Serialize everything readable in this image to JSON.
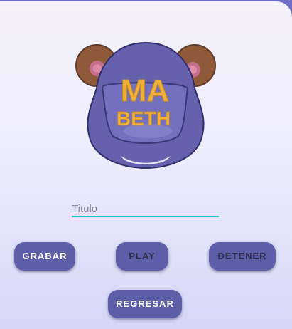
{
  "colors": {
    "header": "#6f6fc4",
    "button": "#5d5ea8",
    "field_underline": "#1fc6c6",
    "logo_body": "#6561ad",
    "logo_ears": "#8f5a3a",
    "logo_letters": "#efb13c"
  },
  "logo": {
    "line1": "MA",
    "line2": "BETH",
    "icon": "mabeth-bear-logo-icon"
  },
  "titulo": {
    "placeholder": "Titulo",
    "value": ""
  },
  "buttons": {
    "grabar": "GRABAR",
    "play": "PLAY",
    "detener": "DETENER",
    "regresar": "REGRESAR"
  }
}
